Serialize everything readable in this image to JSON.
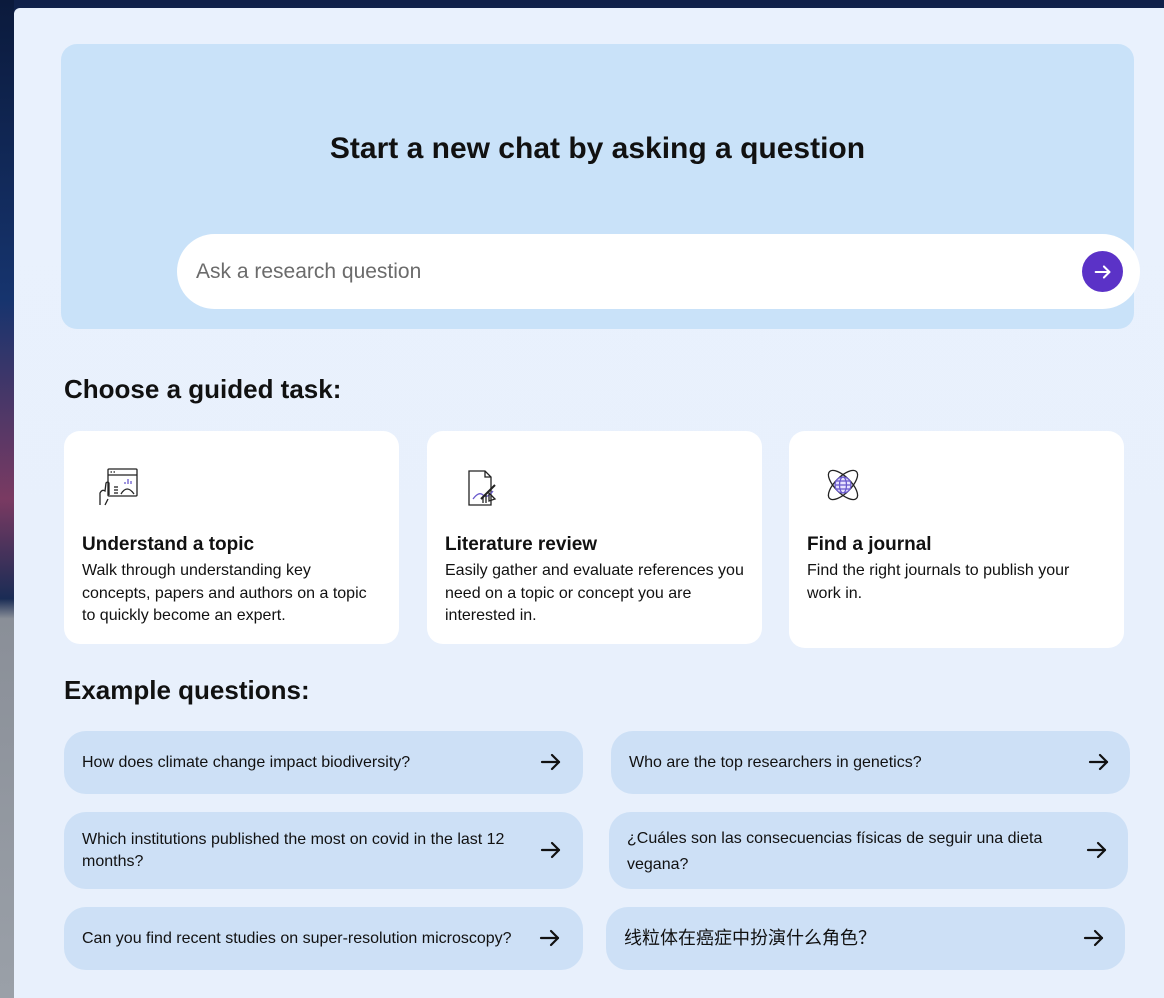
{
  "hero": {
    "title": "Start a new chat by asking a question",
    "search_placeholder": "Ask a research question",
    "accent_color": "#5b32c7"
  },
  "guided": {
    "title": "Choose a guided task:",
    "tasks": [
      {
        "icon": "presentation-hand-icon",
        "title": "Understand a topic",
        "description": "Walk through understanding key concepts, papers and authors on a topic to quickly become an expert."
      },
      {
        "icon": "document-writing-icon",
        "title": "Literature review",
        "description": "Easily gather and evaluate references you need on a topic or concept you are interested in."
      },
      {
        "icon": "atom-globe-icon",
        "title": "Find a journal",
        "description": "Find the right journals to publish your work in."
      }
    ]
  },
  "examples": {
    "title": "Example questions:",
    "questions": [
      "How does climate change impact biodiversity?",
      "Who are the top researchers in genetics?",
      "Which institutions published the most on covid in the last 12 months?",
      "¿Cuáles son las consecuencias físicas de seguir una dieta vegana?",
      "Can you find recent studies on super-resolution microscopy?",
      "线粒体在癌症中扮演什么角色？"
    ]
  }
}
